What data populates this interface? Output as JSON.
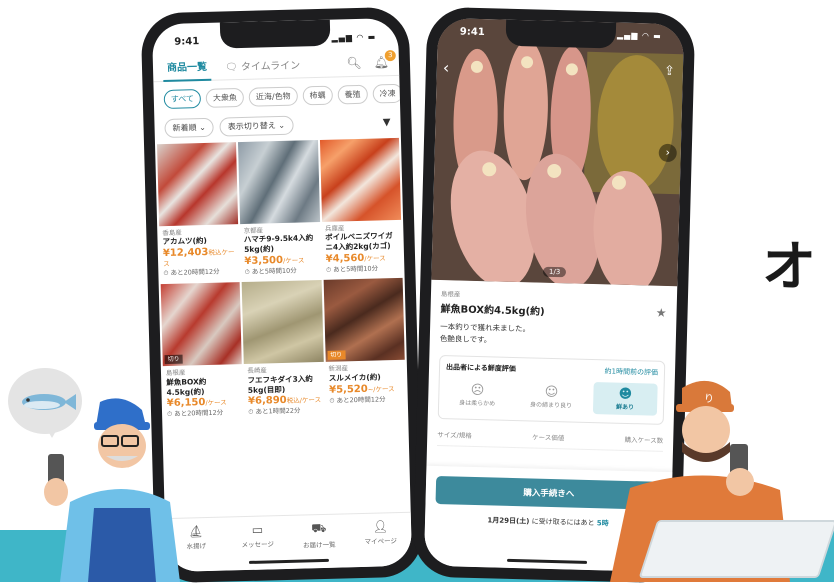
{
  "phone_left": {
    "status_time": "9:41",
    "tabs": [
      "商品一覧",
      "タイムライン"
    ],
    "notification_count": "3",
    "categories": [
      "すべて",
      "大衆魚",
      "近海/色物",
      "柿蠣",
      "養殖",
      "冷凍"
    ],
    "sort_label": "新着順",
    "view_label": "表示切り替え",
    "products": [
      {
        "origin": "香島産",
        "name": "アカムツ(約)",
        "price": "¥12,403",
        "unit": "税込ケース",
        "time": "あと20時間12分",
        "tag": ""
      },
      {
        "origin": "京都産",
        "name": "ハマチ9-9.5k4入約5kg(約)",
        "price": "¥3,500",
        "unit": "/ケース",
        "time": "あと5時間10分",
        "tag": ""
      },
      {
        "origin": "兵庫産",
        "name": "ボイルベニズワイガニ4入約2kg(カゴ)",
        "price": "¥4,560",
        "unit": "/ケース",
        "time": "あと5時間10分",
        "tag": ""
      },
      {
        "origin": "島根産",
        "name": "鮮魚BOX約4.5kg(約)",
        "price": "¥6,150",
        "unit": "/ケース",
        "time": "あと20時間12分",
        "tag": "切り"
      },
      {
        "origin": "長崎産",
        "name": "フエフキダイ3入約5kg(目即)",
        "price": "¥6,890",
        "unit": "税込/ケース",
        "time": "あと1時間22分",
        "tag": ""
      },
      {
        "origin": "新潟産",
        "name": "スルメイカ(約)",
        "price": "¥5,520",
        "unit": "~/ケース",
        "time": "あと20時間12分",
        "tag": "切り"
      }
    ],
    "bottom_nav": [
      "水揚げ",
      "メッセージ",
      "お届け一覧",
      "マイページ"
    ]
  },
  "phone_right": {
    "status_time": "9:41",
    "pager": "1/3",
    "origin": "島根産",
    "title": "鮮魚BOX約4.5kg(約)",
    "desc_line1": "一本釣りで獲れ未ました。",
    "desc_line2": "色艶良しです。",
    "eval_title": "出品者による鮮度評価",
    "eval_link": "約1時間前の評価",
    "eval_options": [
      "身は柔らかめ",
      "身の締まり良り",
      "鮮あり"
    ],
    "columns": [
      "サイズ/規格",
      "ケース価値",
      "購入ケース数"
    ],
    "buy_button": "購入手続きへ",
    "ship_date": "1月29日(土)",
    "ship_text": "に受け取るにはあと",
    "ship_time": "5時"
  },
  "side_text": "オ",
  "colors": {
    "accent": "#1f8aa0",
    "price": "#e8892a",
    "band": "#3fb6c8"
  }
}
